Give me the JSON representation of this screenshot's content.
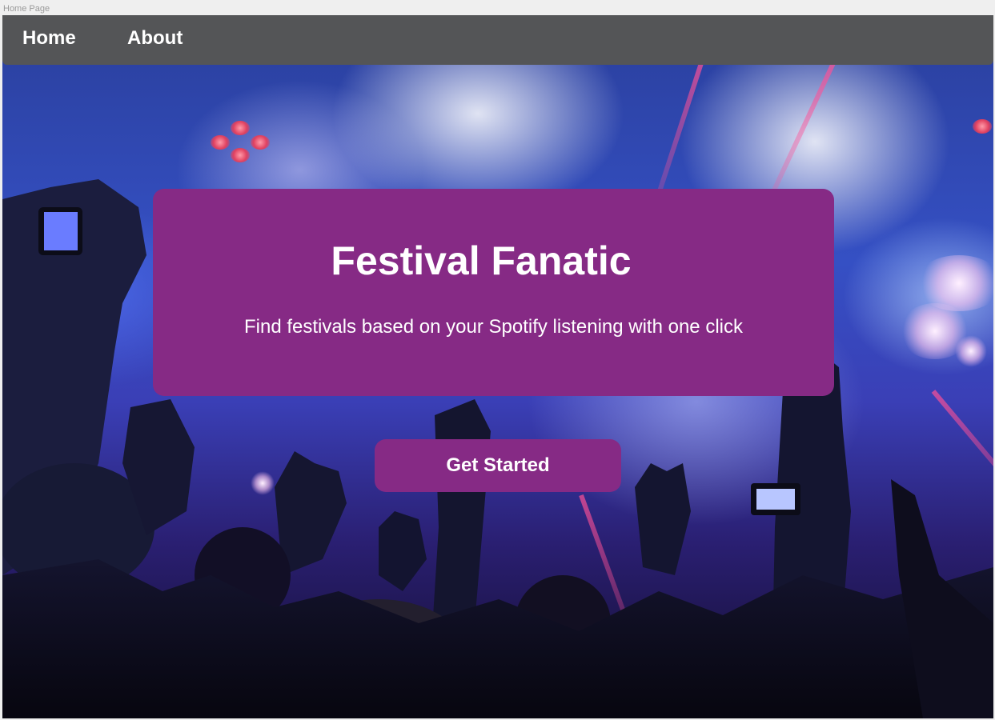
{
  "frame": {
    "label": "Home Page"
  },
  "nav": {
    "items": [
      {
        "label": "Home"
      },
      {
        "label": "About"
      }
    ]
  },
  "hero": {
    "title": "Festival Fanatic",
    "subtitle": "Find festivals based on your Spotify listening with one click",
    "cta_label": "Get Started",
    "background_image": "concert-crowd-photo"
  },
  "colors": {
    "navbar": "#545557",
    "accent_purple": "#862a85",
    "text": "#ffffff"
  }
}
